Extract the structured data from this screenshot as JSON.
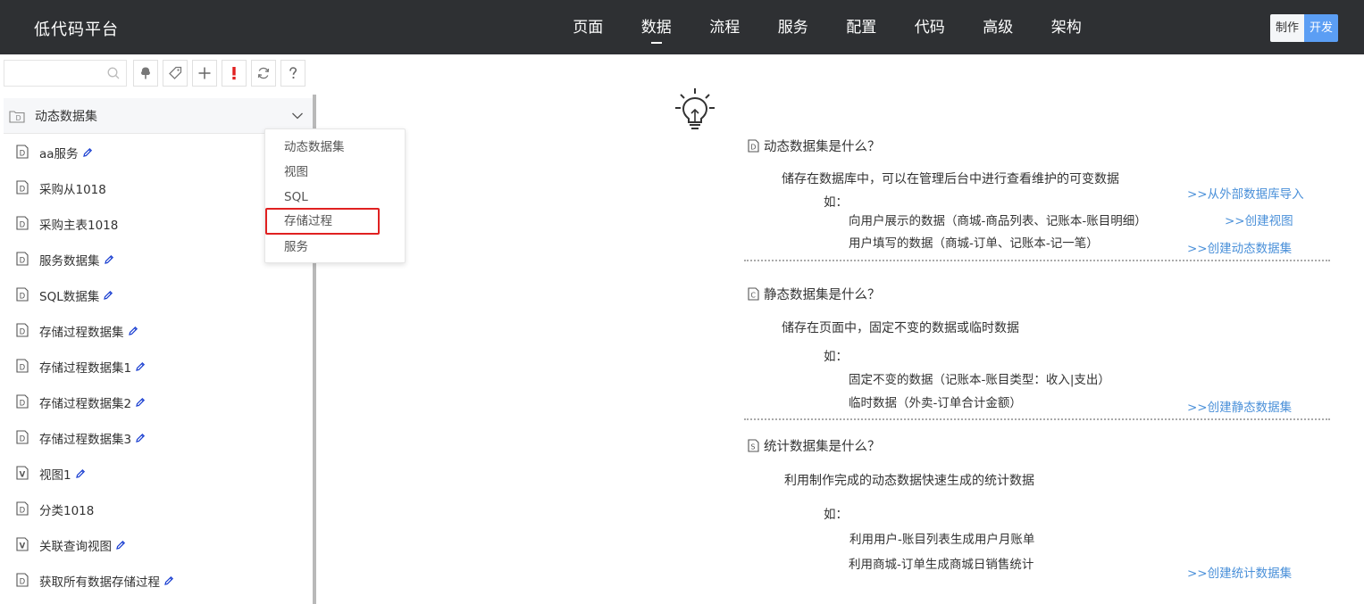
{
  "app": {
    "title": "低代码平台"
  },
  "nav": {
    "items": [
      "页面",
      "数据",
      "流程",
      "服务",
      "配置",
      "代码",
      "高级",
      "架构"
    ],
    "active": "数据"
  },
  "mode": {
    "make": "制作",
    "dev": "开发",
    "active": "开发"
  },
  "colors": {
    "topbar": "#2e3033",
    "accent": "#5b9ef4",
    "link": "#4a90d9",
    "pencil": "#1a3fd1",
    "highlight_border": "#e02020",
    "warning": "#e02020"
  },
  "toolbar": {
    "search": {
      "value": "",
      "placeholder": ""
    },
    "buttons": [
      "tree-icon",
      "tag-icon",
      "plus-icon",
      "exclamation-icon",
      "refresh-icon",
      "question-icon"
    ]
  },
  "sidebar": {
    "section": {
      "label": "动态数据集",
      "icon": "dataset-icon",
      "expanded": true
    },
    "items": [
      {
        "type": "D",
        "name": "aa服务",
        "editable": true
      },
      {
        "type": "D",
        "name": "采购从1018",
        "editable": false
      },
      {
        "type": "D",
        "name": "采购主表1018",
        "editable": false
      },
      {
        "type": "D",
        "name": "服务数据集",
        "editable": true
      },
      {
        "type": "D",
        "name": "SQL数据集",
        "editable": true
      },
      {
        "type": "D",
        "name": "存储过程数据集",
        "editable": true
      },
      {
        "type": "D",
        "name": "存储过程数据集1",
        "editable": true
      },
      {
        "type": "D",
        "name": "存储过程数据集2",
        "editable": true
      },
      {
        "type": "D",
        "name": "存储过程数据集3",
        "editable": true
      },
      {
        "type": "V",
        "name": "视图1",
        "editable": true
      },
      {
        "type": "D",
        "name": "分类1018",
        "editable": false
      },
      {
        "type": "V",
        "name": "关联查询视图",
        "editable": true
      },
      {
        "type": "D",
        "name": "获取所有数据存储过程",
        "editable": true
      }
    ]
  },
  "context_menu": {
    "items": [
      "动态数据集",
      "视图",
      "SQL",
      "存储过程",
      "服务"
    ],
    "highlighted": "存储过程"
  },
  "content": {
    "blocks": [
      {
        "tag": "D",
        "title": "动态数据集是什么？",
        "desc": "储存在数据库中，可以在管理后台中进行查看维护的可变数据",
        "eg_label": "如：",
        "examples": [
          "向用户展示的数据（商城-商品列表、记账本-账目明细）",
          "用户填写的数据（商城-订单、记账本-记一笔）"
        ],
        "links": [
          ">>从外部数据库导入",
          ">>创建视图",
          ">>创建动态数据集"
        ]
      },
      {
        "tag": "C",
        "title": "静态数据集是什么？",
        "desc": "储存在页面中，固定不变的数据或临时数据",
        "eg_label": "如：",
        "examples": [
          "固定不变的数据（记账本-账目类型：收入|支出）",
          "临时数据（外卖-订单合计金额）"
        ],
        "links": [
          ">>创建静态数据集"
        ]
      },
      {
        "tag": "S",
        "title": "统计数据集是什么？",
        "desc": "利用制作完成的动态数据快速生成的统计数据",
        "eg_label": "如：",
        "examples": [
          "利用用户-账目列表生成用户月账单",
          "利用商城-订单生成商城日销售统计"
        ],
        "links": [
          ">>创建统计数据集"
        ]
      }
    ]
  }
}
